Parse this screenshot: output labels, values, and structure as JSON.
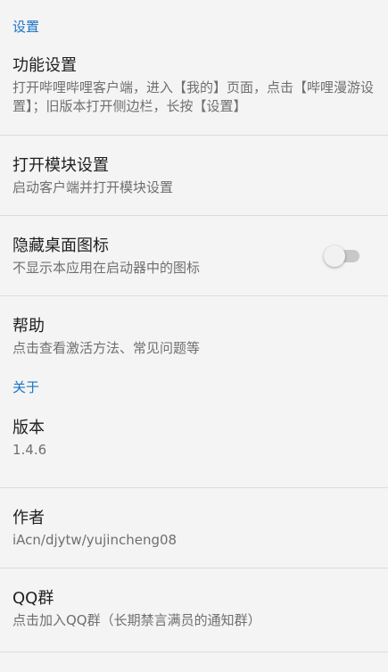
{
  "sections": {
    "settings_header": "设置",
    "about_header": "关于"
  },
  "items": {
    "feature_settings": {
      "title": "功能设置",
      "summary": "打开哔哩哔哩客户端，进入【我的】页面，点击【哔哩漫游设置】；旧版本打开侧边栏，长按【设置】"
    },
    "open_module_settings": {
      "title": "打开模块设置",
      "summary": "启动客户端并打开模块设置"
    },
    "hide_launcher_icon": {
      "title": "隐藏桌面图标",
      "summary": "不显示本应用在启动器中的图标",
      "checked": false
    },
    "help": {
      "title": "帮助",
      "summary": "点击查看激活方法、常见问题等"
    },
    "version": {
      "title": "版本",
      "summary": "1.4.6"
    },
    "author": {
      "title": "作者",
      "summary": "iAcn/djytw/yujincheng08"
    },
    "qq_group": {
      "title": "QQ群",
      "summary": "点击加入QQ群（长期禁言满员的通知群）"
    }
  },
  "colors": {
    "accent": "#1a73c8",
    "background": "#f4f4f4"
  }
}
